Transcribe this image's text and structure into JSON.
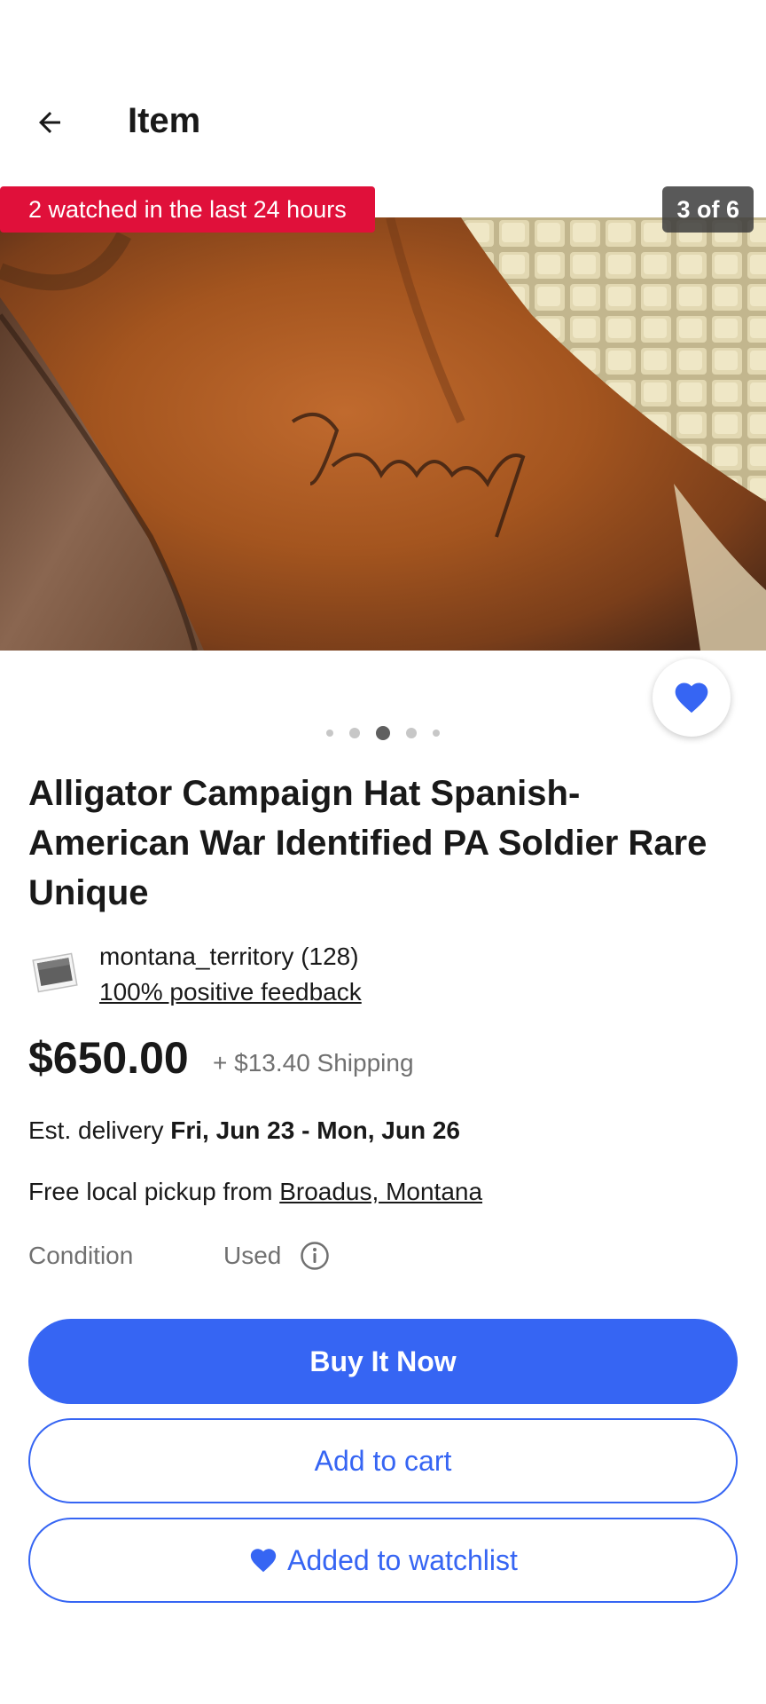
{
  "header": {
    "title": "Item",
    "back_icon": "arrow-left-icon"
  },
  "gallery": {
    "watch_badge": "2 watched in the last 24 hours",
    "counter": "3 of 6",
    "dots_total": 5,
    "dots_active_index": 2,
    "watch_icon": "heart-icon",
    "colors": {
      "watch_badge": "#e0103a",
      "heart": "#3665f3"
    }
  },
  "item": {
    "title": "Alligator Campaign Hat Spanish-American War Identified PA Soldier Rare Unique"
  },
  "seller": {
    "name": "montana_territory (128)",
    "feedback": "100% positive feedback",
    "icon": "seller-photo-icon"
  },
  "price": {
    "amount": "$650.00",
    "shipping": "+ $13.40 Shipping"
  },
  "delivery": {
    "label": "Est. delivery ",
    "dates": "Fri, Jun 23 - Mon, Jun 26"
  },
  "pickup": {
    "label": "Free local pickup from ",
    "location": "Broadus, Montana"
  },
  "condition": {
    "label": "Condition",
    "value": "Used",
    "info_icon": "info-icon"
  },
  "actions": {
    "buy_now": "Buy It Now",
    "add_to_cart": "Add to cart",
    "watchlist": "Added to watchlist",
    "accent": "#3665f3"
  }
}
